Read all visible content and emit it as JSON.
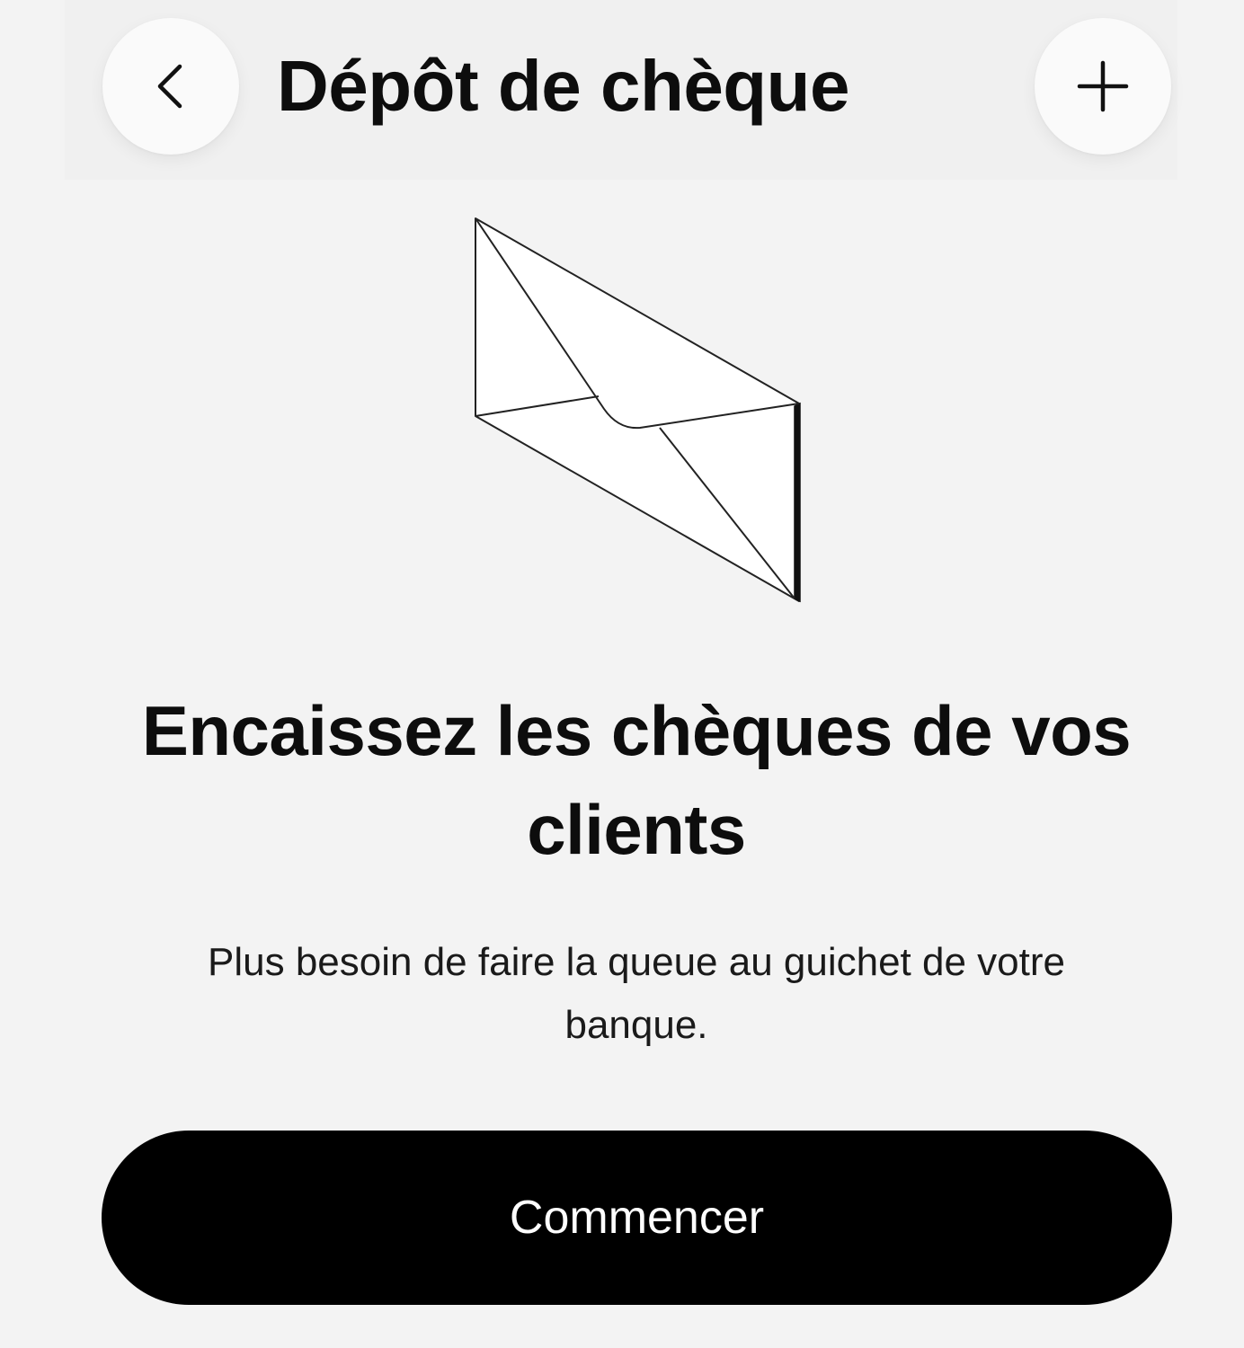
{
  "header": {
    "title": "Dépôt de chèque",
    "back_icon": "chevron-left-icon",
    "add_icon": "plus-icon"
  },
  "illustration": {
    "icon": "envelope-icon"
  },
  "main": {
    "headline": "Encaissez les chèques de vos clients",
    "subtitle": "Plus besoin de faire la queue au guichet de votre banque."
  },
  "actions": {
    "start_label": "Commencer"
  },
  "colors": {
    "background": "#f3f3f3",
    "primary_button": "#000000",
    "primary_button_text": "#ffffff",
    "text": "#0d0d0d"
  }
}
